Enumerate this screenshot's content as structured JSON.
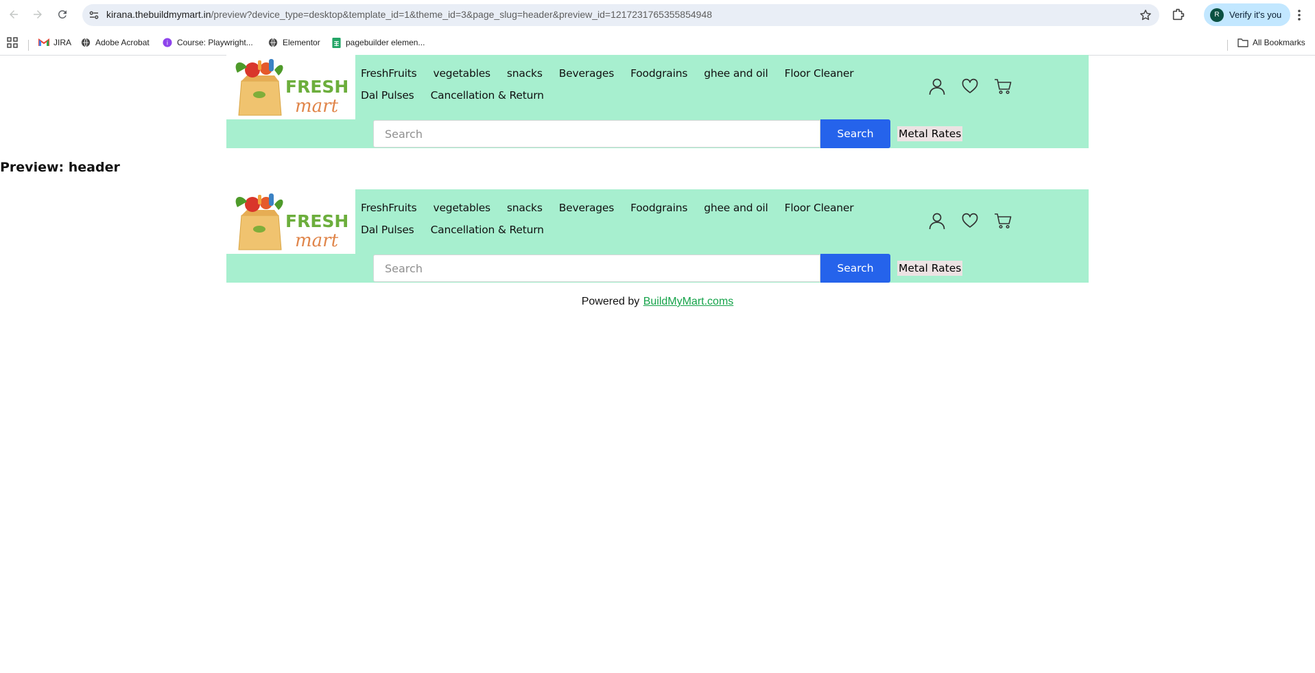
{
  "browser": {
    "url_host": "kirana.thebuildmymart.in",
    "url_rest": "/preview?device_type=desktop&template_id=1&theme_id=3&page_slug=header&preview_id=1217231765355854948",
    "profile_initial": "R",
    "profile_label": "Verify it's you",
    "bookmarks": [
      "JIRA",
      "Adobe Acrobat",
      "Course: Playwright...",
      "Elementor",
      "pagebuilder elemen..."
    ],
    "all_bookmarks": "All Bookmarks"
  },
  "header": {
    "logo_text_top": "FRESH",
    "logo_text_bottom": "mart",
    "nav_row1": [
      "FreshFruits",
      "vegetables",
      "snacks",
      "Beverages",
      "Foodgrains",
      "ghee and oil",
      "Floor Cleaner"
    ],
    "nav_row2": [
      "Dal Pulses",
      "Cancellation & Return"
    ],
    "search_placeholder": "Search",
    "search_button": "Search",
    "metal_rates": "Metal Rates"
  },
  "preview_title": "Preview: header",
  "footer": {
    "prefix": "Powered by",
    "link": "BuildMyMart.coms"
  },
  "colors": {
    "header_bg": "#a7efcf",
    "search_button": "#2563eb",
    "footer_link": "#16a34a"
  }
}
